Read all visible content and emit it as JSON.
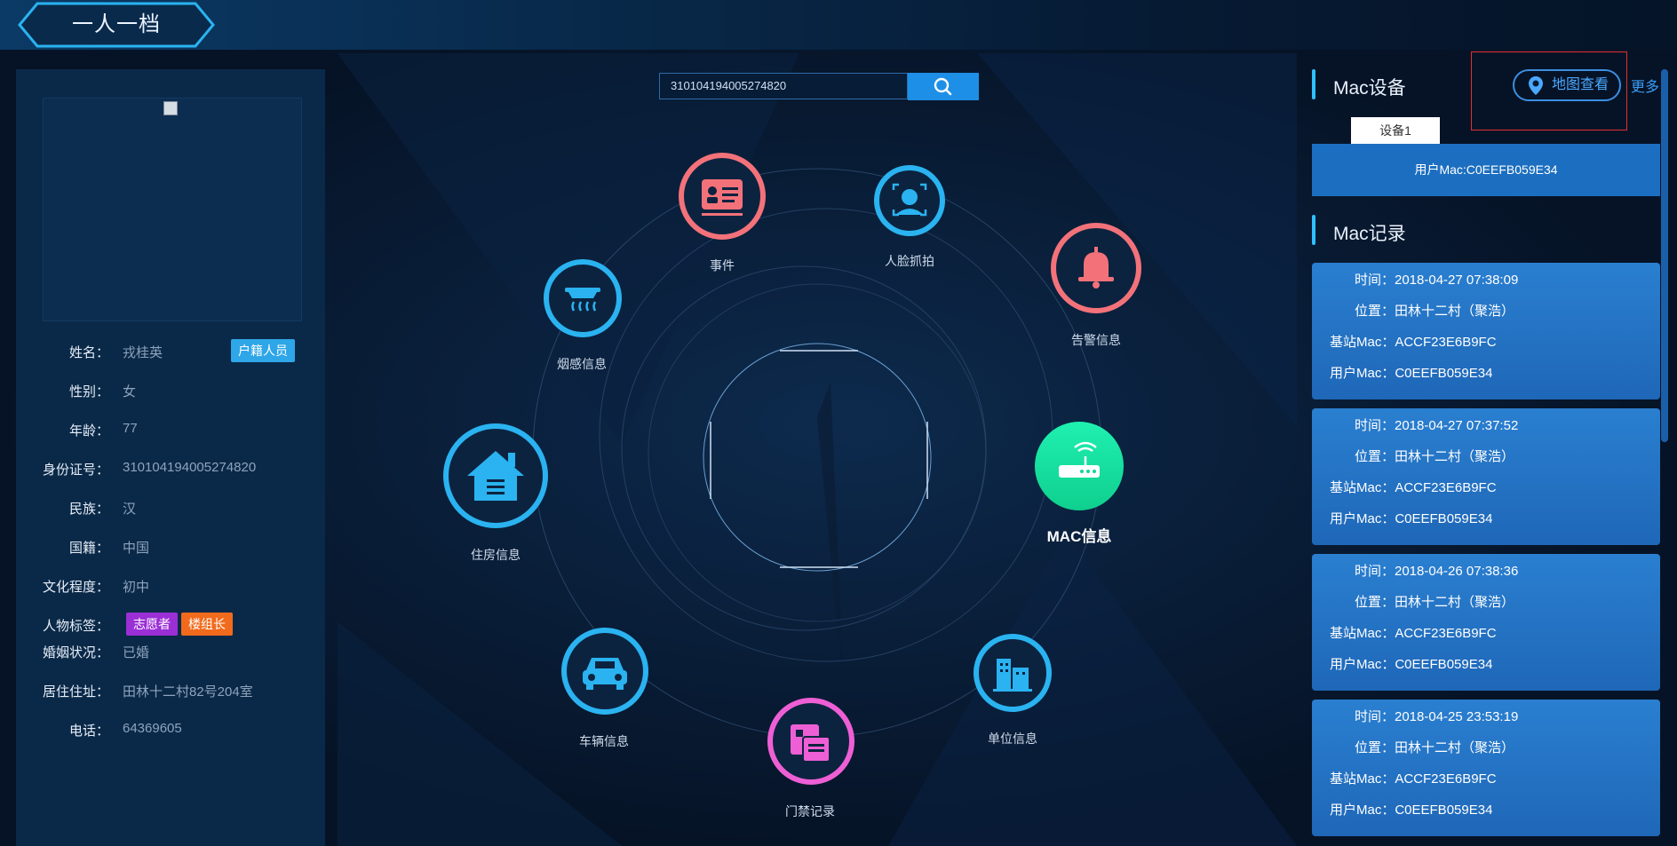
{
  "header": {
    "title": "一人一档"
  },
  "person": {
    "photo_alt": "",
    "fields": [
      {
        "label": "姓名：",
        "value": "戎桂英"
      },
      {
        "label": "性别：",
        "value": "女"
      },
      {
        "label": "年龄：",
        "value": "77"
      },
      {
        "label": "身份证号：",
        "value": "310104194005274820"
      },
      {
        "label": "民族：",
        "value": "汉"
      },
      {
        "label": "国籍：",
        "value": "中国"
      },
      {
        "label": "文化程度：",
        "value": "初中"
      },
      {
        "label": "人物标签：",
        "value": ""
      },
      {
        "label": "婚姻状况：",
        "value": "已婚"
      },
      {
        "label": "居住住址：",
        "value": "田林十二村82号204室"
      },
      {
        "label": "电话：",
        "value": "64369605"
      }
    ],
    "name_badge": "户籍人员",
    "tags": [
      {
        "label": "志愿者",
        "color": "#9b2fd6"
      },
      {
        "label": "楼组长",
        "color": "#f26a1b"
      }
    ]
  },
  "search": {
    "value": "310104194005274820",
    "icon": "search-icon"
  },
  "nodes": [
    {
      "key": "event",
      "label": "事件",
      "icon": "id-card-icon",
      "color": "#f3727a"
    },
    {
      "key": "face",
      "label": "人脸抓拍",
      "icon": "face-scan-icon",
      "color": "#2ab3f0"
    },
    {
      "key": "alarm",
      "label": "告警信息",
      "icon": "bell-icon",
      "color": "#f3727a"
    },
    {
      "key": "mac",
      "label": "MAC信息",
      "icon": "router-icon",
      "color": "#17e0a2"
    },
    {
      "key": "unit",
      "label": "单位信息",
      "icon": "building-icon",
      "color": "#2ab3f0"
    },
    {
      "key": "access",
      "label": "门禁记录",
      "icon": "access-card-icon",
      "color": "#ee5fd5"
    },
    {
      "key": "vehicle",
      "label": "车辆信息",
      "icon": "car-icon",
      "color": "#2ab3f0"
    },
    {
      "key": "housing",
      "label": "住房信息",
      "icon": "house-icon",
      "color": "#2ab3f0"
    },
    {
      "key": "smoke",
      "label": "烟感信息",
      "icon": "smoke-detector-icon",
      "color": "#2ab3f0"
    }
  ],
  "mac_device": {
    "title": "Mac设备",
    "map_button": "地图查看",
    "more": "更多",
    "tab": "设备1",
    "user_mac": "用户Mac:C0EEFB059E34"
  },
  "mac_records": {
    "title": "Mac记录",
    "items": [
      {
        "time": "时间：2018-04-27 07:38:09",
        "location": "位置：田林十二村（聚浩）",
        "base_mac": "基站Mac：ACCF23E6B9FC",
        "user_mac": "用户Mac：C0EEFB059E34"
      },
      {
        "time": "时间：2018-04-27 07:37:52",
        "location": "位置：田林十二村（聚浩）",
        "base_mac": "基站Mac：ACCF23E6B9FC",
        "user_mac": "用户Mac：C0EEFB059E34"
      },
      {
        "time": "时间：2018-04-26 07:38:36",
        "location": "位置：田林十二村（聚浩）",
        "base_mac": "基站Mac：ACCF23E6B9FC",
        "user_mac": "用户Mac：C0EEFB059E34"
      },
      {
        "time": "时间：2018-04-25 23:53:19",
        "location": "位置：田林十二村（聚浩）",
        "base_mac": "基站Mac：ACCF23E6B9FC",
        "user_mac": "用户Mac：C0EEFB059E34"
      }
    ]
  }
}
